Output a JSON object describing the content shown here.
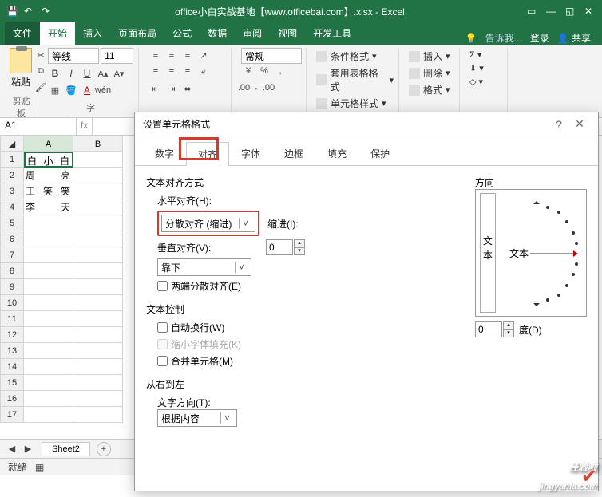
{
  "titlebar": {
    "title": "office小白实战基地【www.officebai.com】.xlsx - Excel"
  },
  "ribbon_tabs": {
    "file": "文件",
    "items": [
      "开始",
      "插入",
      "页面布局",
      "公式",
      "数据",
      "审阅",
      "视图",
      "开发工具"
    ],
    "active_index": 0,
    "tell_me": "告诉我...",
    "login": "登录",
    "share": "共享"
  },
  "ribbon": {
    "paste": "粘贴",
    "clipboard": "剪贴板",
    "font_name": "等线",
    "font_size": "11",
    "font_label": "字",
    "number_format": "常规",
    "cond_fmt": "条件格式",
    "table_fmt": "套用表格格式",
    "cell_style": "单元格样式",
    "insert": "插入",
    "delete": "删除",
    "format": "格式"
  },
  "namebox": {
    "ref": "A1",
    "formula": ""
  },
  "grid": {
    "columns": [
      "A",
      "B"
    ],
    "rows": [
      "1",
      "2",
      "3",
      "4",
      "5",
      "6",
      "7",
      "8",
      "9",
      "10",
      "11",
      "12",
      "13",
      "14",
      "15",
      "16",
      "17"
    ],
    "data": [
      [
        "白 小 白",
        ""
      ],
      [
        "周     亮",
        ""
      ],
      [
        "王 笑 笑",
        ""
      ],
      [
        "李     天",
        ""
      ]
    ]
  },
  "sheetbar": {
    "sheet": "Sheet2",
    "plus": "+"
  },
  "statusbar": {
    "ready": "就绪"
  },
  "dialog": {
    "title": "设置单元格格式",
    "tabs": [
      "数字",
      "对齐",
      "字体",
      "边框",
      "填充",
      "保护"
    ],
    "active_tab": 1,
    "text_align_label": "文本对齐方式",
    "horizontal_label": "水平对齐(H):",
    "horizontal_value": "分散对齐 (缩进)",
    "indent_label": "缩进(I):",
    "indent_value": "0",
    "vertical_label": "垂直对齐(V):",
    "vertical_value": "靠下",
    "justify_dist": "两端分散对齐(E)",
    "text_control_label": "文本控制",
    "wrap": "自动换行(W)",
    "shrink": "缩小字体填充(K)",
    "merge": "合并单元格(M)",
    "rtl_label": "从右到左",
    "text_dir_label": "文字方向(T):",
    "text_dir_value": "根据内容",
    "orientation_label": "方向",
    "orient_v": "文本",
    "orient_h": "文本",
    "degree_value": "0",
    "degree_label": "度(D)"
  },
  "watermark": {
    "main": "经验啦",
    "sub": "jingyanla.com"
  }
}
